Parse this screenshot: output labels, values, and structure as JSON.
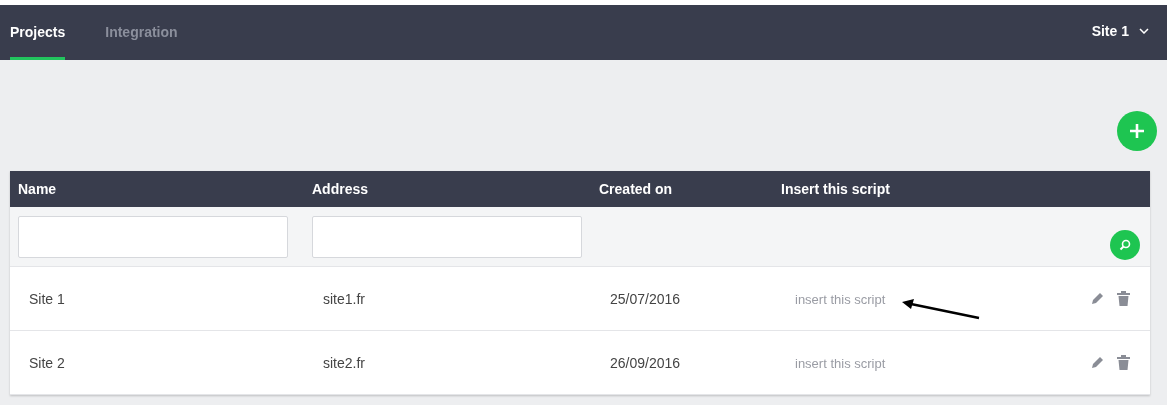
{
  "nav": {
    "tabs": [
      {
        "label": "Projects",
        "selected": true
      },
      {
        "label": "Integration",
        "selected": false
      }
    ],
    "site_menu": "Site 1"
  },
  "table": {
    "columns": [
      "Name",
      "Address",
      "Created on",
      "Insert this script"
    ],
    "filters": [
      {
        "kind": "input"
      },
      {
        "kind": "input"
      }
    ],
    "rows": [
      {
        "name": "Site 1",
        "address": "site1.fr",
        "created": "25/07/2016",
        "script": "insert this script",
        "annotated": true
      },
      {
        "name": "Site 2",
        "address": "site2.fr",
        "created": "26/09/2016",
        "script": "insert this script",
        "annotated": false
      }
    ]
  }
}
